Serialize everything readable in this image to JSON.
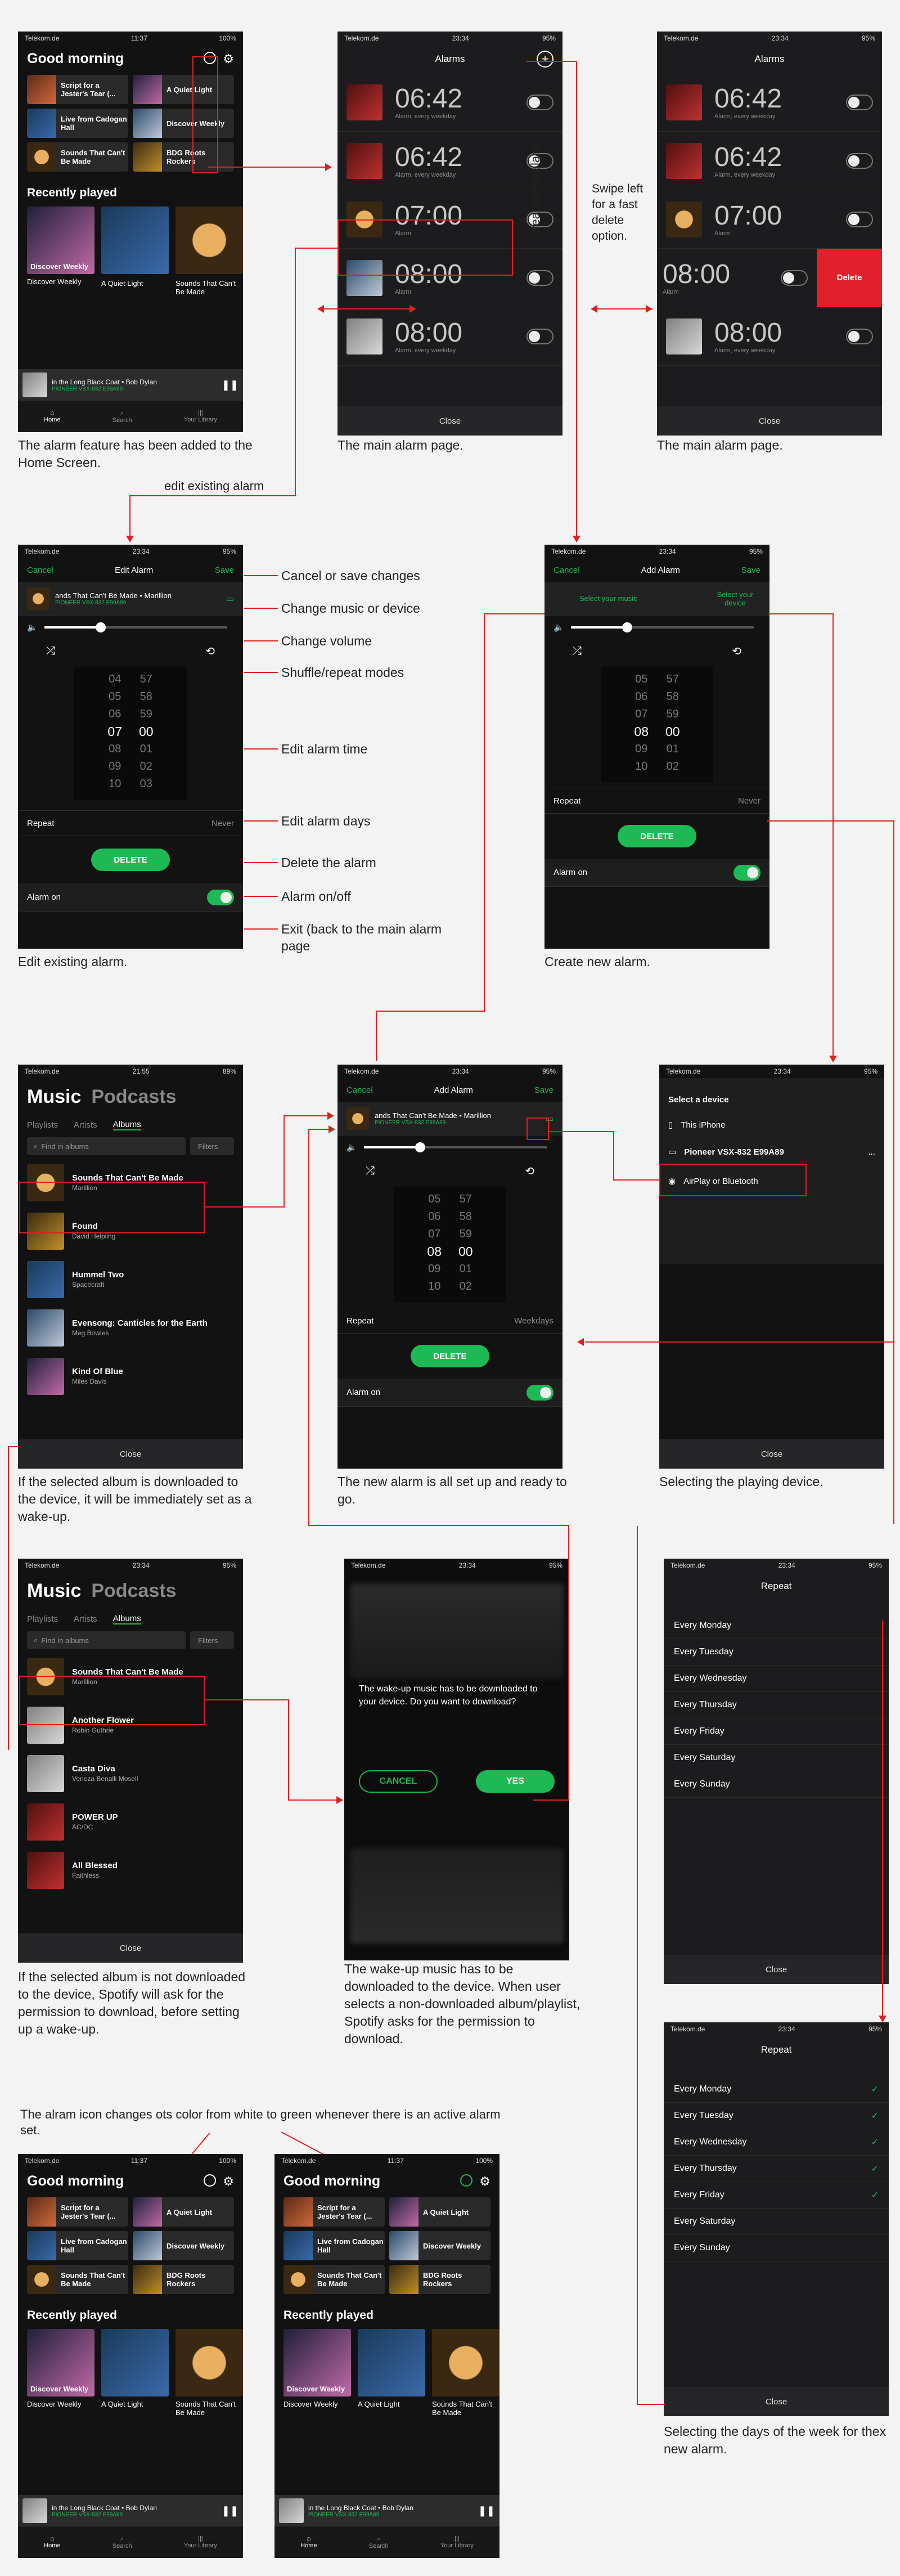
{
  "status": {
    "carrier": "Telekom.de",
    "wifi": "wifi-icon",
    "t1": "11:37",
    "t2": "23:34",
    "t3": "21:55",
    "b100": "100%",
    "b95": "95%",
    "b89": "89%"
  },
  "home": {
    "greeting": "Good morning",
    "tiles": [
      "Script for a Jester's Tear (...",
      "A Quiet Light",
      "Live from Cadogan Hall",
      "Discover Weekly",
      "Sounds That Can't Be Made",
      "BDG Roots Rockers"
    ],
    "recent_title": "Recently played",
    "recent": [
      "Discover Weekly",
      "A Quiet Light",
      "Sounds That Can't Be Made"
    ],
    "cover_label": "Discover Weekly",
    "mini_track": "in the Long Black Coat • Bob Dylan",
    "mini_device": "PIONEER VSX-832 E99A89",
    "nav": [
      "Home",
      "Search",
      "Your Library"
    ],
    "alarm_icon_white": "#ffffff",
    "alarm_icon_green": "#1db954"
  },
  "alarms": {
    "title": "Alarms",
    "items": [
      {
        "time": "06:42",
        "sub": "Alarm, every weekday"
      },
      {
        "time": "06:42",
        "sub": "Alarm, every weekday"
      },
      {
        "time": "07:00",
        "sub": "Alarm"
      },
      {
        "time": "08:00",
        "sub": "Alarm"
      },
      {
        "time": "08:00",
        "sub": "Alarm, every weekday"
      }
    ],
    "close": "Close",
    "delete": "Delete"
  },
  "edit": {
    "cancel": "Cancel",
    "title": "Edit Alarm",
    "save": "Save",
    "track": "ands That Can't Be Made • Marillion",
    "device": "PIONEER VSX-832 E99A89",
    "hours": [
      "04",
      "05",
      "06",
      "07",
      "08",
      "09",
      "10"
    ],
    "mins": [
      "57",
      "58",
      "59",
      "00",
      "01",
      "02",
      "03"
    ],
    "repeat": "Repeat",
    "repeat_val": "Never",
    "delete": "DELETE",
    "alarm_on": "Alarm on"
  },
  "add": {
    "title": "Add Alarm",
    "select_music": "Select your music",
    "select_device": "Select your device",
    "hours": [
      "05",
      "06",
      "07",
      "08",
      "09",
      "10"
    ],
    "mins": [
      "57",
      "58",
      "59",
      "00",
      "01",
      "02"
    ],
    "repeat_weekdays": "Weekdays"
  },
  "library": {
    "music": "Music",
    "podcasts": "Podcasts",
    "tabs": [
      "Playlists",
      "Artists",
      "Albums"
    ],
    "search": "Find in albums",
    "filters": "Filters",
    "list1": [
      {
        "t": "Sounds That Can't Be Made",
        "a": "Marillion"
      },
      {
        "t": "Found",
        "a": "David Helpling"
      },
      {
        "t": "Hummel Two",
        "a": "Spacecraft"
      },
      {
        "t": "Evensong: Canticles for the Earth",
        "a": "Meg Bowles"
      },
      {
        "t": "Kind Of Blue",
        "a": "Miles Davis"
      }
    ],
    "list2": [
      {
        "t": "Sounds That Can't Be Made",
        "a": "Marillion"
      },
      {
        "t": "Another Flower",
        "a": "Robin Guthrie"
      },
      {
        "t": "Casta Diva",
        "a": "Veneza Benalli Mosell"
      },
      {
        "t": "POWER UP",
        "a": "AC/DC"
      },
      {
        "t": "All Blessed",
        "a": "Faithless"
      }
    ],
    "close": "Close"
  },
  "device": {
    "title": "Select a device",
    "items": [
      "This iPhone",
      "Pioneer VSX-832 E99A89",
      "AirPlay or Bluetooth"
    ],
    "close": "Close",
    "more": "..."
  },
  "download": {
    "text": "The wake-up music has to be downloaded to your device. Do you want to download?",
    "cancel": "CANCEL",
    "yes": "YES"
  },
  "repeat": {
    "title": "Repeat",
    "days": [
      "Every Monday",
      "Every Tuesday",
      "Every Wednesday",
      "Every Thursday",
      "Every Friday",
      "Every Saturday",
      "Every Sunday"
    ],
    "close": "Close"
  },
  "annotations": {
    "create_new": "create new alarm",
    "swipe": "Swipe left for a fast delete option.",
    "edit_existing": "edit existing alarm",
    "cancel_save": "Cancel or save changes",
    "change_music": "Change music or device",
    "change_volume": "Change volume",
    "shuffle": "Shuffle/repeat modes",
    "edit_time": "Edit alarm time",
    "edit_days": "Edit alarm days",
    "delete_alarm": "Delete the alarm",
    "alarm_onoff": "Alarm on/off",
    "exit": "Exit (back to the main alarm page",
    "icon_note": "The alram icon changes ots color from white to green whenever  there is an active alarm set."
  },
  "captions": {
    "c1": "The alarm feature has been added to the Home Screen.",
    "c2": "The main alarm page.",
    "c3": "The main alarm page.",
    "c4": "Edit existing alarm.",
    "c5": "Create new alarm.",
    "c6": "If the selected album is downloaded to the device, it will be immediately set as a wake-up.",
    "c7": "The new alarm is all set up and ready to go.",
    "c8": "Selecting the playing device.",
    "c9": "If the selected album is not downloaded to the device, Spotify will ask for the permission to download, before setting up a wake-up.",
    "c10": "The wake-up music has to be downloaded to the device. When user selects a non-downloaded album/playlist, Spotify asks for the permission to download.",
    "c11": "Selecting the days of the week for thex new alarm."
  }
}
